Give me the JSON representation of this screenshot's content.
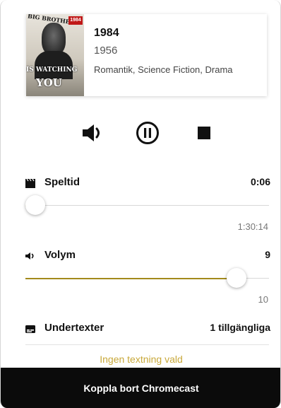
{
  "movie": {
    "title": "1984",
    "year": "1956",
    "genres": "Romantik, Science Fiction, Drama",
    "poster_text": {
      "top": "BIG BROTHER",
      "middle": "IS WATCHING",
      "bottom": "YOU",
      "badge": "1984"
    }
  },
  "controls": {
    "volume_icon": "volume-icon",
    "pause_icon": "pause-icon",
    "stop_icon": "stop-icon"
  },
  "playtime": {
    "label": "Speltid",
    "icon": "clapperboard-icon",
    "current": "0:06",
    "total": "1:30:14",
    "progress_fraction": 0.0011
  },
  "volume": {
    "label": "Volym",
    "icon": "volume-icon",
    "value": "9",
    "max": "10",
    "fraction": 0.9
  },
  "subtitles": {
    "label": "Undertexter",
    "icon": "subtitles-icon",
    "status": "1 tillgängliga",
    "selected": "Ingen textning vald"
  },
  "footer": {
    "disconnect_label": "Koppla bort Chromecast"
  },
  "colors": {
    "accent": "#a38a1c",
    "footer_bg": "#0b0b0b"
  }
}
